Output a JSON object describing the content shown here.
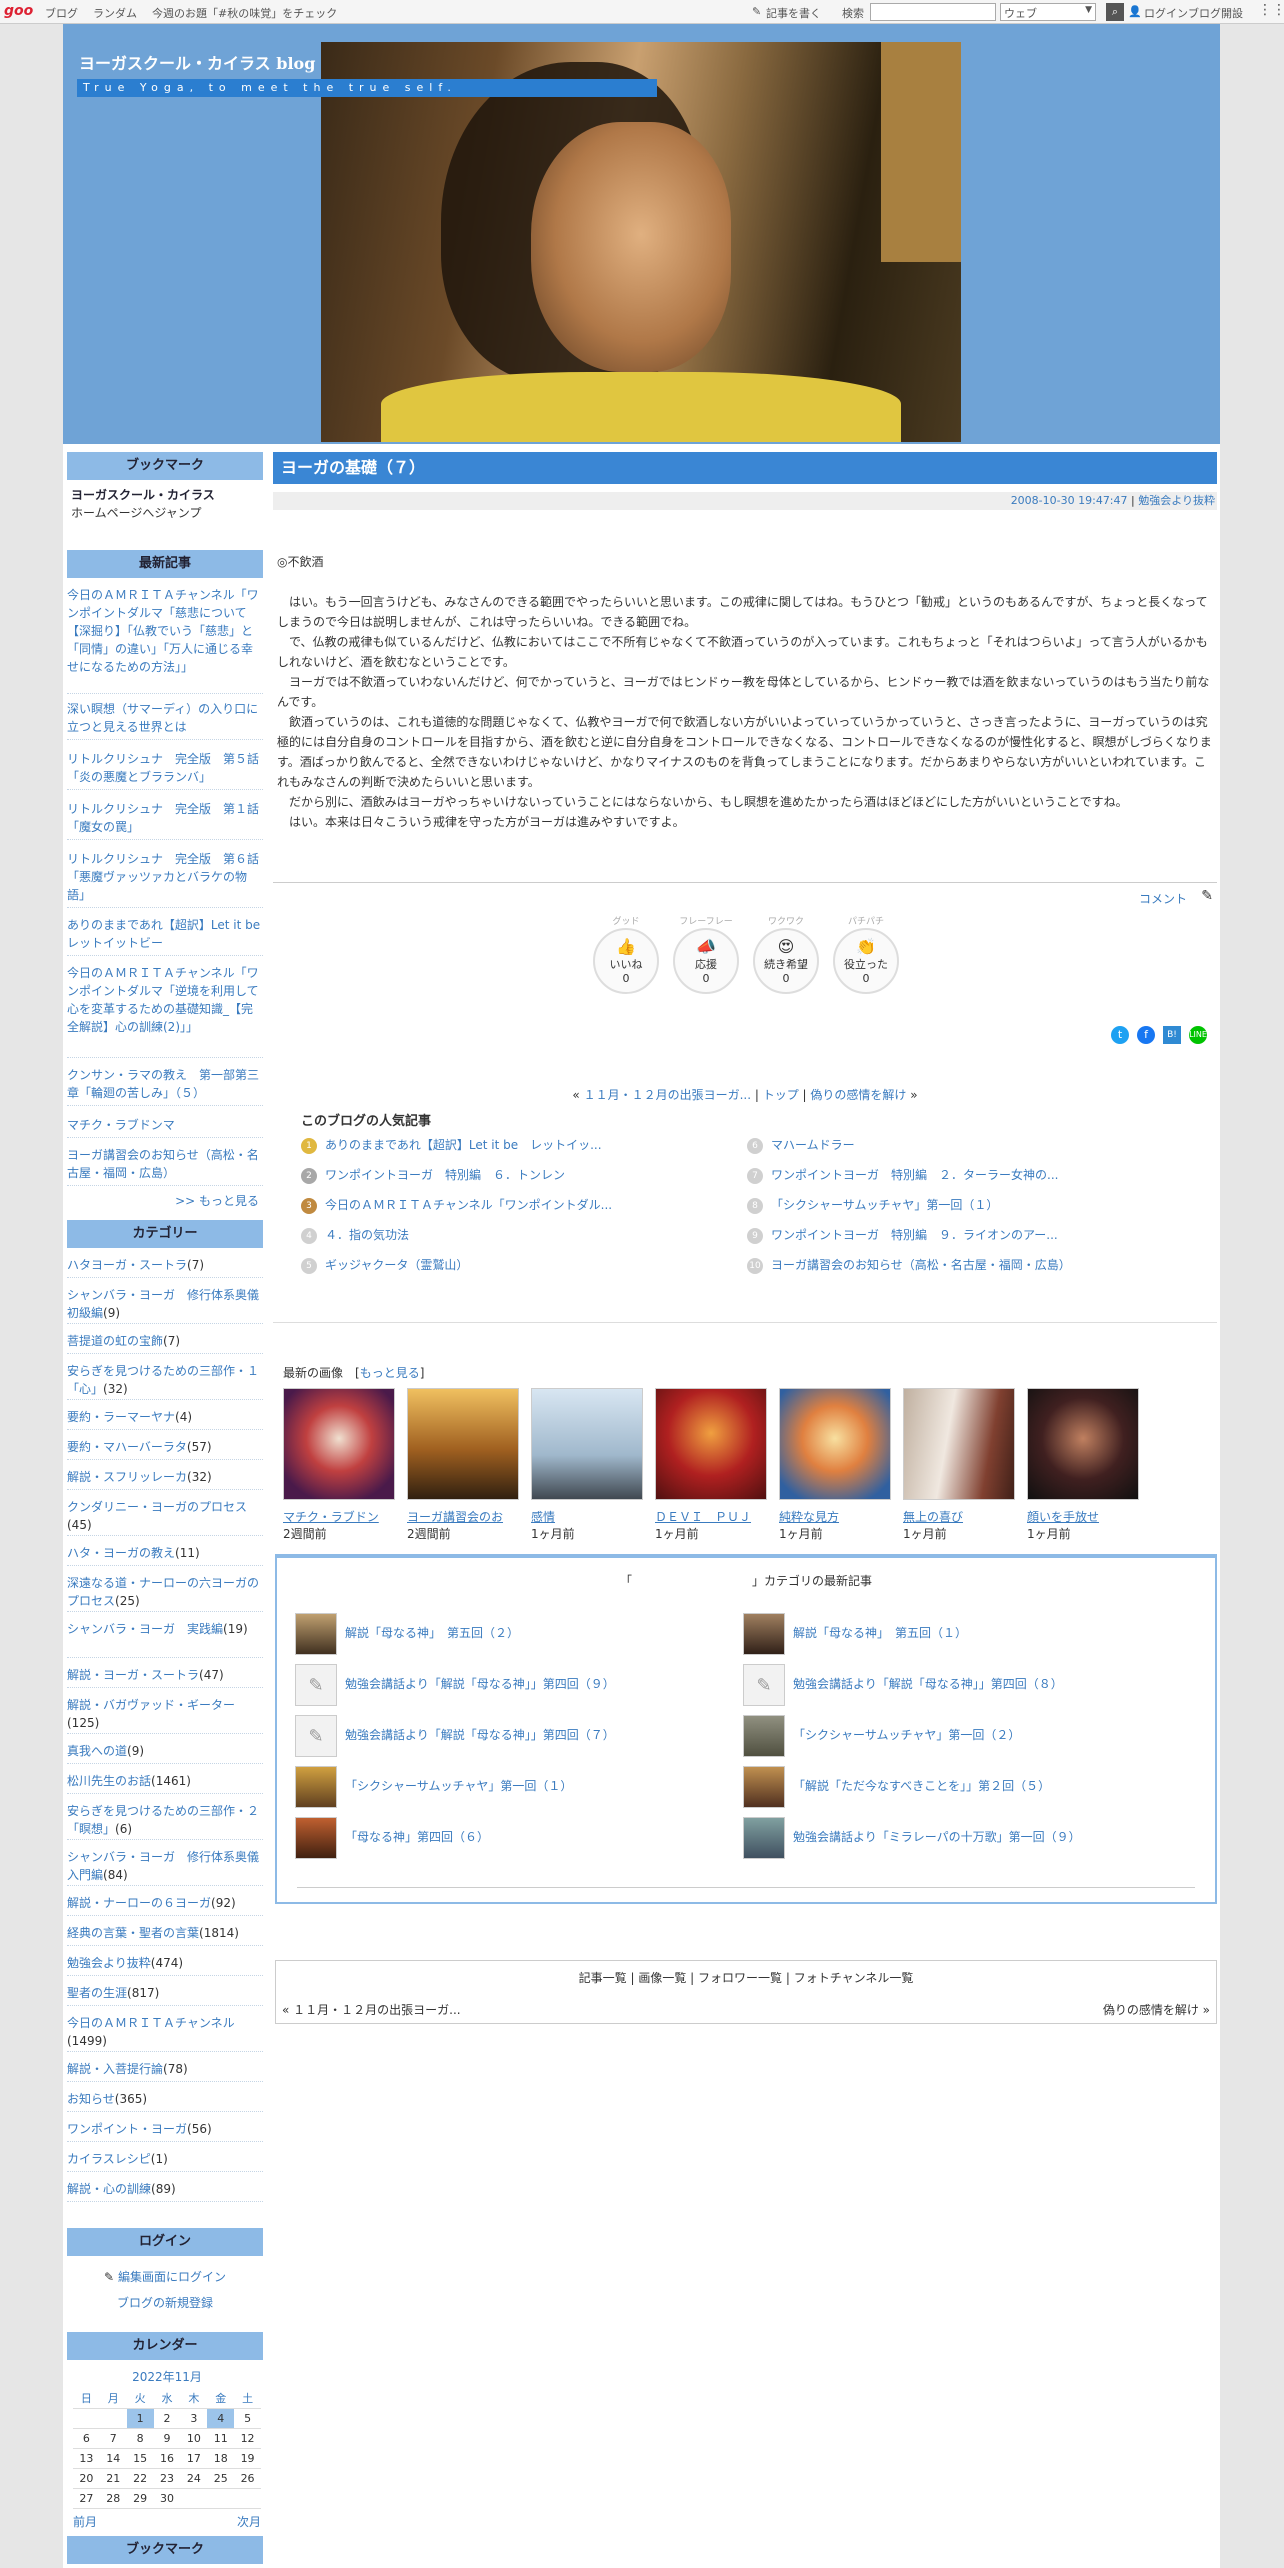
{
  "topbar": {
    "logo": "goo",
    "links": [
      "ブログ",
      "ランダム",
      "今週のお題「#秋の味覚」をチェック"
    ],
    "write": "記事を書く",
    "search_label": "検索",
    "search_value": "",
    "search_select": "ウェブ",
    "login": "ログイン",
    "blog_open": "ブログ開設"
  },
  "header": {
    "title": "ヨーガスクール・カイラス blog",
    "subtitle": "True Yoga, to meet the true self."
  },
  "sidebar": {
    "bookmark": {
      "heading": "ブックマーク",
      "link": "ヨーガスクール・カイラス",
      "desc": "ホームページへジャンプ"
    },
    "recent": {
      "heading": "最新記事",
      "items": [
        "今日のＡＭＲＩＴＡチャンネル「ワンポイントダルマ「慈悲について【深掘り】「仏教でいう「慈悲」と「同情」の違い」「万人に通じる幸せになるための方法」」",
        "深い瞑想（サマーディ）の入り口に立つと見える世界とは",
        "リトルクリシュナ　完全版　第５話「炎の悪魔とブラランバ」",
        "リトルクリシュナ　完全版　第１話「魔女の罠」",
        "リトルクリシュナ　完全版　第６話「悪魔ヴァッツァカとバラケの物語」",
        "ありのままであれ【超訳】Let it be　レットイットビー",
        "今日のＡＭＲＩＴＡチャンネル「ワンポイントダルマ「逆境を利用して心を変革するための基礎知識_【完全解説】心の訓練(2)」」",
        "クンサン・ラマの教え　第一部第三章「輪廻の苦しみ」（５）",
        "マチク・ラブドンマ",
        "ヨーガ講習会のお知らせ（高松・名古屋・福岡・広島）"
      ],
      "more": ">> もっと見る"
    },
    "category": {
      "heading": "カテゴリー",
      "items": [
        {
          "name": "ハタヨーガ・スートラ",
          "count": "(7)"
        },
        {
          "name": "シャンバラ・ヨーガ　修行体系奥儀　初級編",
          "count": "(9)"
        },
        {
          "name": "菩提道の虹の宝飾",
          "count": "(7)"
        },
        {
          "name": "安らぎを見つけるための三部作・１「心」",
          "count": "(32)"
        },
        {
          "name": "要約・ラーマーヤナ",
          "count": "(4)"
        },
        {
          "name": "要約・マハーバーラタ",
          "count": "(57)"
        },
        {
          "name": "解説・スフリッレーカ",
          "count": "(32)"
        },
        {
          "name": "クンダリニー・ヨーガのプロセス",
          "count": "(45)"
        },
        {
          "name": "ハタ・ヨーガの教え",
          "count": "(11)"
        },
        {
          "name": "深遠なる道・ナーローの六ヨーガのプロセス",
          "count": "(25)"
        },
        {
          "name": "シャンバラ・ヨーガ　実践編",
          "count": "(19)"
        },
        {
          "name": "解説・ヨーガ・スートラ",
          "count": "(47)"
        },
        {
          "name": "解説・バガヴァッド・ギーター",
          "count": "(125)"
        },
        {
          "name": "真我への道",
          "count": "(9)"
        },
        {
          "name": "松川先生のお話",
          "count": "(1461)"
        },
        {
          "name": "安らぎを見つけるための三部作・２「瞑想」",
          "count": "(6)"
        },
        {
          "name": "シャンバラ・ヨーガ　修行体系奥儀　入門編",
          "count": "(84)"
        },
        {
          "name": "解説・ナーローの６ヨーガ",
          "count": "(92)"
        },
        {
          "name": "経典の言葉・聖者の言葉",
          "count": "(1814)"
        },
        {
          "name": "勉強会より抜粋",
          "count": "(474)"
        },
        {
          "name": "聖者の生涯",
          "count": "(817)"
        },
        {
          "name": "今日のＡＭＲＩＴＡチャンネル",
          "count": "(1499)"
        },
        {
          "name": "解説・入菩提行論",
          "count": "(78)"
        },
        {
          "name": "お知らせ",
          "count": "(365)"
        },
        {
          "name": "ワンポイント・ヨーガ",
          "count": "(56)"
        },
        {
          "name": "カイラスレシピ",
          "count": "(1)"
        },
        {
          "name": "解説・心の訓練",
          "count": "(89)"
        }
      ]
    },
    "login": {
      "heading": "ログイン",
      "edit": "編集画面にログイン",
      "register": "ブログの新規登録"
    },
    "calendar": {
      "heading": "カレンダー",
      "month": "2022年11月",
      "weekdays": [
        "日",
        "月",
        "火",
        "水",
        "木",
        "金",
        "土"
      ],
      "days": [
        "",
        "",
        "1",
        "2",
        "3",
        "4",
        "5",
        "6",
        "7",
        "8",
        "9",
        "10",
        "11",
        "12",
        "13",
        "14",
        "15",
        "16",
        "17",
        "18",
        "19",
        "20",
        "21",
        "22",
        "23",
        "24",
        "25",
        "26",
        "27",
        "28",
        "29",
        "30",
        "",
        "",
        ""
      ],
      "prev": "前月",
      "next": "次月"
    },
    "next_heading": "ブックマーク"
  },
  "article": {
    "title": "ヨーガの基礎（７）",
    "date": "2008-10-30 19:47:47",
    "category": "勉強会より抜粋",
    "heading": "◎不飲酒",
    "paragraphs": [
      "　はい。もう一回言うけども、みなさんのできる範囲でやったらいいと思います。この戒律に関してはね。もうひとつ「勧戒」というのもあるんですが、ちょっと長くなってしまうので今日は説明しませんが、これは守ったらいいね。できる範囲でね。",
      "　で、仏教の戒律も似ているんだけど、仏教においてはここで不所有じゃなくて不飲酒っていうのが入っています。これもちょっと「それはつらいよ」って言う人がいるかもしれないけど、酒を飲むなということです。",
      "　ヨーガでは不飲酒っていわないんだけど、何でかっていうと、ヨーガではヒンドゥー教を母体としているから、ヒンドゥー教では酒を飲まないっていうのはもう当たり前なんです。",
      "　飲酒っていうのは、これも道徳的な問題じゃなくて、仏教やヨーガで何で飲酒しない方がいいよっていっていうかっていうと、さっき言ったように、ヨーガっていうのは究極的には自分自身のコントロールを目指すから、酒を飲むと逆に自分自身をコントロールできなくなる、コントロールできなくなるのが慢性化すると、瞑想がしづらくなります。酒ばっかり飲んでると、全然できないわけじゃないけど、かなりマイナスのものを背負ってしまうことになります。だからあまりやらない方がいいといわれています。これもみなさんの判断で決めたらいいと思います。",
      "　だから別に、酒飲みはヨーガやっちゃいけないっていうことにはならないから、もし瞑想を進めたかったら酒はほどほどにした方がいいということですね。",
      "　はい。本来は日々こういう戒律を守った方がヨーガは進みやすいですよ。"
    ],
    "comment": "コメント",
    "reactions": [
      {
        "top": "グッド",
        "label": "いいね",
        "count": "0"
      },
      {
        "top": "フレーフレー",
        "label": "応援",
        "count": "0"
      },
      {
        "top": "ワクワク",
        "label": "続き希望",
        "count": "0"
      },
      {
        "top": "パチパチ",
        "label": "役立った",
        "count": "0"
      }
    ],
    "nav": {
      "prev": "１１月・１２月の出張ヨーガ...",
      "top": "トップ",
      "next": "偽りの感情を解け"
    }
  },
  "popular": {
    "heading": "このブログの人気記事",
    "items": [
      "ありのままであれ【超訳】Let it be　レットイッ...",
      "ワンポイントヨーガ　特別編　６．トンレン",
      "今日のＡＭＲＩＴＡチャンネル「ワンポイントダル...",
      "４．指の気功法",
      "ギッジャクータ（霊鷲山）",
      "マハームドラー",
      "ワンポイントヨーガ　特別編　２．ターラー女神の...",
      "「シクシャーサムッチャヤ」第一回（１）",
      "ワンポイントヨーガ　特別編　９．ライオンのアー...",
      "ヨーガ講習会のお知らせ（高松・名古屋・福岡・広島）"
    ],
    "ranks": [
      "1",
      "2",
      "3",
      "4",
      "5",
      "6",
      "7",
      "8",
      "9",
      "10"
    ]
  },
  "images": {
    "heading": "最新の画像",
    "more": "もっと見る",
    "items": [
      {
        "cap": "マチク・ラブドン",
        "ago": "2週間前"
      },
      {
        "cap": "ヨーガ講習会のお",
        "ago": "2週間前"
      },
      {
        "cap": "感情",
        "ago": "1ヶ月前"
      },
      {
        "cap": "ＤＥＶＩ　ＰＵＪ",
        "ago": "1ヶ月前"
      },
      {
        "cap": "純粋な見方",
        "ago": "1ヶ月前"
      },
      {
        "cap": "無上の喜び",
        "ago": "1ヶ月前"
      },
      {
        "cap": "顔いを手放せ",
        "ago": "1ヶ月前"
      }
    ]
  },
  "cat_recent": {
    "heading": "「　　　　　　　　　　」カテゴリの最新記事",
    "items": [
      "解説「母なる神」　第五回（２）",
      "解説「母なる神」　第五回（１）",
      "勉強会講話より「解説「母なる神」」第四回（９）",
      "勉強会講話より「解説「母なる神」」第四回（８）",
      "勉強会講話より「解説「母なる神」」第四回（７）",
      "「シクシャーサムッチャヤ」第一回（２）",
      "「シクシャーサムッチャヤ」第一回（１）",
      "「解説「ただ今なすべきことを」」第２回（５）",
      "「母なる神」第四回（６）",
      "勉強会講話より「ミラレーパの十万歌」第一回（９）"
    ]
  },
  "footer": {
    "links": [
      "記事一覧",
      "画像一覧",
      "フォロワー一覧",
      "フォトチャンネル一覧"
    ],
    "prev": "１１月・１２月の出張ヨーガ...",
    "next": "偽りの感情を解け"
  }
}
